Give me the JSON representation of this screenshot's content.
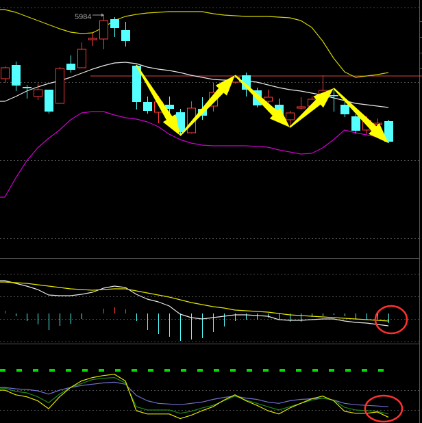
{
  "colors": {
    "up": "#ff3b3b",
    "down": "#54ffff",
    "upper_band": "#d4d400",
    "mid_band": "#e8e8e8",
    "lower_band": "#d000d0",
    "dif": "#e8e8e8",
    "dea": "#e6e600",
    "k": "#1a8a1a",
    "d": "#7070d0",
    "j": "#e6e600",
    "ref_dash": "#00dd00",
    "arrow": "#ffff00",
    "circle": "#ff3030",
    "grid": "#555555",
    "resistance": "#e04040"
  },
  "chart_data": [
    {
      "type": "candlestick",
      "title": "",
      "annotation": {
        "label": "5984",
        "price": 5984
      },
      "resistance_level": 5628,
      "ylim": [
        4564,
        6072
      ],
      "candles": [
        {
          "o": 5612,
          "c": 5676,
          "h": 5684,
          "l": 5588
        },
        {
          "o": 5692,
          "c": 5572,
          "h": 5712,
          "l": 5540
        },
        {
          "o": 5564,
          "c": 5556,
          "h": 5576,
          "l": 5496
        },
        {
          "o": 5508,
          "c": 5548,
          "h": 5584,
          "l": 5488
        },
        {
          "o": 5548,
          "c": 5420,
          "h": 5548,
          "l": 5408
        },
        {
          "o": 5468,
          "c": 5672,
          "h": 5680,
          "l": 5468
        },
        {
          "o": 5700,
          "c": 5664,
          "h": 5748,
          "l": 5648
        },
        {
          "o": 5676,
          "c": 5784,
          "h": 5824,
          "l": 5676
        },
        {
          "o": 5840,
          "c": 5848,
          "h": 5880,
          "l": 5804
        },
        {
          "o": 5844,
          "c": 5952,
          "h": 5984,
          "l": 5784
        },
        {
          "o": 5960,
          "c": 5908,
          "h": 5972,
          "l": 5856
        },
        {
          "o": 5896,
          "c": 5832,
          "h": 5944,
          "l": 5800
        },
        {
          "o": 5688,
          "c": 5476,
          "h": 5692,
          "l": 5432
        },
        {
          "o": 5476,
          "c": 5424,
          "h": 5508,
          "l": 5408
        },
        {
          "o": 5416,
          "c": 5476,
          "h": 5512,
          "l": 5352
        },
        {
          "o": 5460,
          "c": 5436,
          "h": 5508,
          "l": 5392
        },
        {
          "o": 5416,
          "c": 5300,
          "h": 5436,
          "l": 5280
        },
        {
          "o": 5296,
          "c": 5440,
          "h": 5480,
          "l": 5292
        },
        {
          "o": 5436,
          "c": 5396,
          "h": 5504,
          "l": 5372
        },
        {
          "o": 5452,
          "c": 5532,
          "h": 5588,
          "l": 5420
        },
        {
          "o": 5540,
          "c": 5568,
          "h": 5600,
          "l": 5532
        },
        {
          "o": 5592,
          "c": 5620,
          "h": 5632,
          "l": 5584
        },
        {
          "o": 5632,
          "c": 5548,
          "h": 5648,
          "l": 5508
        },
        {
          "o": 5544,
          "c": 5456,
          "h": 5560,
          "l": 5444
        },
        {
          "o": 5480,
          "c": 5504,
          "h": 5548,
          "l": 5420
        },
        {
          "o": 5460,
          "c": 5372,
          "h": 5496,
          "l": 5368
        },
        {
          "o": 5372,
          "c": 5412,
          "h": 5424,
          "l": 5328
        },
        {
          "o": 5440,
          "c": 5448,
          "h": 5504,
          "l": 5432
        },
        {
          "o": 5452,
          "c": 5492,
          "h": 5508,
          "l": 5432
        },
        {
          "o": 5524,
          "c": 5544,
          "h": 5632,
          "l": 5512
        },
        {
          "o": 5516,
          "c": 5512,
          "h": 5556,
          "l": 5420
        },
        {
          "o": 5460,
          "c": 5404,
          "h": 5492,
          "l": 5388
        },
        {
          "o": 5392,
          "c": 5308,
          "h": 5404,
          "l": 5292
        },
        {
          "o": 5312,
          "c": 5368,
          "h": 5396,
          "l": 5288
        },
        {
          "o": 5348,
          "c": 5352,
          "h": 5380,
          "l": 5312
        },
        {
          "o": 5364,
          "c": 5244,
          "h": 5372,
          "l": 5236
        }
      ],
      "bollinger": {
        "upper": [
          6016,
          6000,
          5976,
          5952,
          5928,
          5904,
          5884,
          5876,
          5880,
          5912,
          5952,
          5976,
          5988,
          5996,
          6000,
          6004,
          6004,
          6004,
          6004,
          5992,
          5984,
          5980,
          5976,
          5976,
          5976,
          5972,
          5968,
          5952,
          5912,
          5832,
          5732,
          5652,
          5620,
          5628,
          5636,
          5648
        ],
        "mid": [
          5480,
          5508,
          5540,
          5564,
          5584,
          5600,
          5620,
          5644,
          5668,
          5688,
          5704,
          5708,
          5700,
          5680,
          5668,
          5660,
          5648,
          5632,
          5620,
          5608,
          5604,
          5604,
          5600,
          5592,
          5576,
          5560,
          5548,
          5540,
          5528,
          5516,
          5500,
          5484,
          5468,
          5460,
          5452,
          5444
        ],
        "lower": [
          4920,
          5032,
          5132,
          5208,
          5264,
          5312,
          5372,
          5412,
          5420,
          5420,
          5400,
          5384,
          5376,
          5360,
          5332,
          5288,
          5256,
          5236,
          5224,
          5220,
          5220,
          5220,
          5220,
          5216,
          5212,
          5196,
          5184,
          5172,
          5176,
          5208,
          5256,
          5312,
          5296,
          5284,
          5272,
          5256
        ]
      },
      "trend_arrows": [
        [
          12,
          16
        ],
        [
          16,
          21
        ],
        [
          21,
          26
        ],
        [
          26,
          30
        ],
        [
          30,
          35
        ]
      ]
    },
    {
      "type": "bar+line",
      "title": "MACD",
      "histogram": [
        8,
        -8,
        -22,
        -32,
        -48,
        -36,
        -30,
        -16,
        0,
        14,
        18,
        12,
        -22,
        -48,
        -60,
        -68,
        -80,
        -76,
        -72,
        -54,
        -38,
        -22,
        -18,
        -18,
        -12,
        -18,
        -24,
        -24,
        -10,
        -8,
        -4,
        -8,
        -18,
        -18,
        -16,
        -28
      ],
      "dif": [
        96,
        88,
        80,
        70,
        54,
        52,
        52,
        56,
        62,
        74,
        80,
        76,
        56,
        42,
        34,
        22,
        -2,
        -12,
        -16,
        -12,
        -8,
        -4,
        -4,
        -6,
        -8,
        -18,
        -20,
        -20,
        -18,
        -16,
        -16,
        -22,
        -26,
        -28,
        -32,
        -36
      ],
      "dea": [
        92,
        90,
        88,
        84,
        80,
        76,
        72,
        70,
        68,
        70,
        72,
        72,
        66,
        60,
        54,
        48,
        40,
        32,
        26,
        20,
        16,
        10,
        8,
        6,
        4,
        0,
        -4,
        -6,
        -8,
        -10,
        -12,
        -14,
        -16,
        -18,
        -20,
        -22
      ],
      "ylim": [
        -82,
        162
      ]
    },
    {
      "type": "line",
      "title": "KDJ",
      "reference_level": 80,
      "gridlines": [
        80,
        50,
        20
      ],
      "k": [
        53,
        48,
        46,
        40,
        31,
        44,
        54,
        60,
        66,
        68,
        69,
        61,
        25,
        20,
        20,
        20,
        15,
        18,
        23,
        27,
        34,
        41,
        35,
        30,
        25,
        20,
        25,
        30,
        35,
        38,
        35,
        24,
        20,
        19,
        18,
        14
      ],
      "d": [
        54,
        52,
        51,
        49,
        44,
        50,
        54,
        57,
        59,
        61,
        62,
        59,
        42,
        34,
        30,
        29,
        28,
        30,
        32,
        36,
        39,
        41,
        38,
        36,
        32,
        30,
        34,
        36,
        37,
        38,
        35,
        30,
        28,
        27,
        26,
        25
      ],
      "j": [
        50,
        43,
        40,
        34,
        22,
        40,
        54,
        64,
        69,
        72,
        74,
        64,
        19,
        14,
        14,
        14,
        7,
        12,
        19,
        25,
        35,
        43,
        34,
        27,
        19,
        14,
        23,
        30,
        37,
        41,
        34,
        18,
        15,
        15,
        17,
        9
      ],
      "ylim": [
        -4,
        116
      ]
    }
  ]
}
